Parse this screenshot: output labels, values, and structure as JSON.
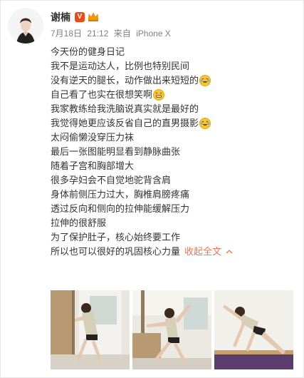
{
  "user": {
    "name": "谢楠",
    "vip_badge": "V"
  },
  "meta": {
    "date": "7月18日",
    "time": "21:12",
    "from_prefix": "来自",
    "source": "iPhone X"
  },
  "post": {
    "lines": [
      {
        "text": "今天份的健身日记"
      },
      {
        "text": "我不是运动达人，比例也特别民间"
      },
      {
        "text": "没有逆天的腿长，动作做出来短短的",
        "emoji": "laugh-cry-emoji"
      },
      {
        "text": "自己看了也实在很想笑啊",
        "emoji": "grin-emoji"
      },
      {
        "text": "我家教练给我洗脑说真实就是最好的"
      },
      {
        "text": "我觉得她更应该反省自己的直男摄影",
        "emoji": "laugh-cry-emoji"
      },
      {
        "text": "太闷偷懒没穿压力袜"
      },
      {
        "text": "最后一张图能明显看到静脉曲张"
      },
      {
        "text": "随着子宫和胸部增大"
      },
      {
        "text": "很多孕妇会不自觉地驼背含肩"
      },
      {
        "text": "身体前侧压力过大，胸椎肩膀疼痛"
      },
      {
        "text": "透过反向和侧向的拉伸能缓解压力"
      },
      {
        "text": "拉伸的很舒服"
      },
      {
        "text": "为了保护肚子，核心始终要工作"
      },
      {
        "text": "所以也可以很好的巩固核心力量"
      }
    ],
    "collapse_label": "收起全文",
    "collapse_icon": "chevron-up-icon"
  },
  "photos": [
    {
      "name": "photo-1"
    },
    {
      "name": "photo-2"
    },
    {
      "name": "photo-3"
    }
  ],
  "colors": {
    "link": "#eb7350",
    "meta": "#808080",
    "text": "#333333",
    "vip": "#e94b1b"
  }
}
